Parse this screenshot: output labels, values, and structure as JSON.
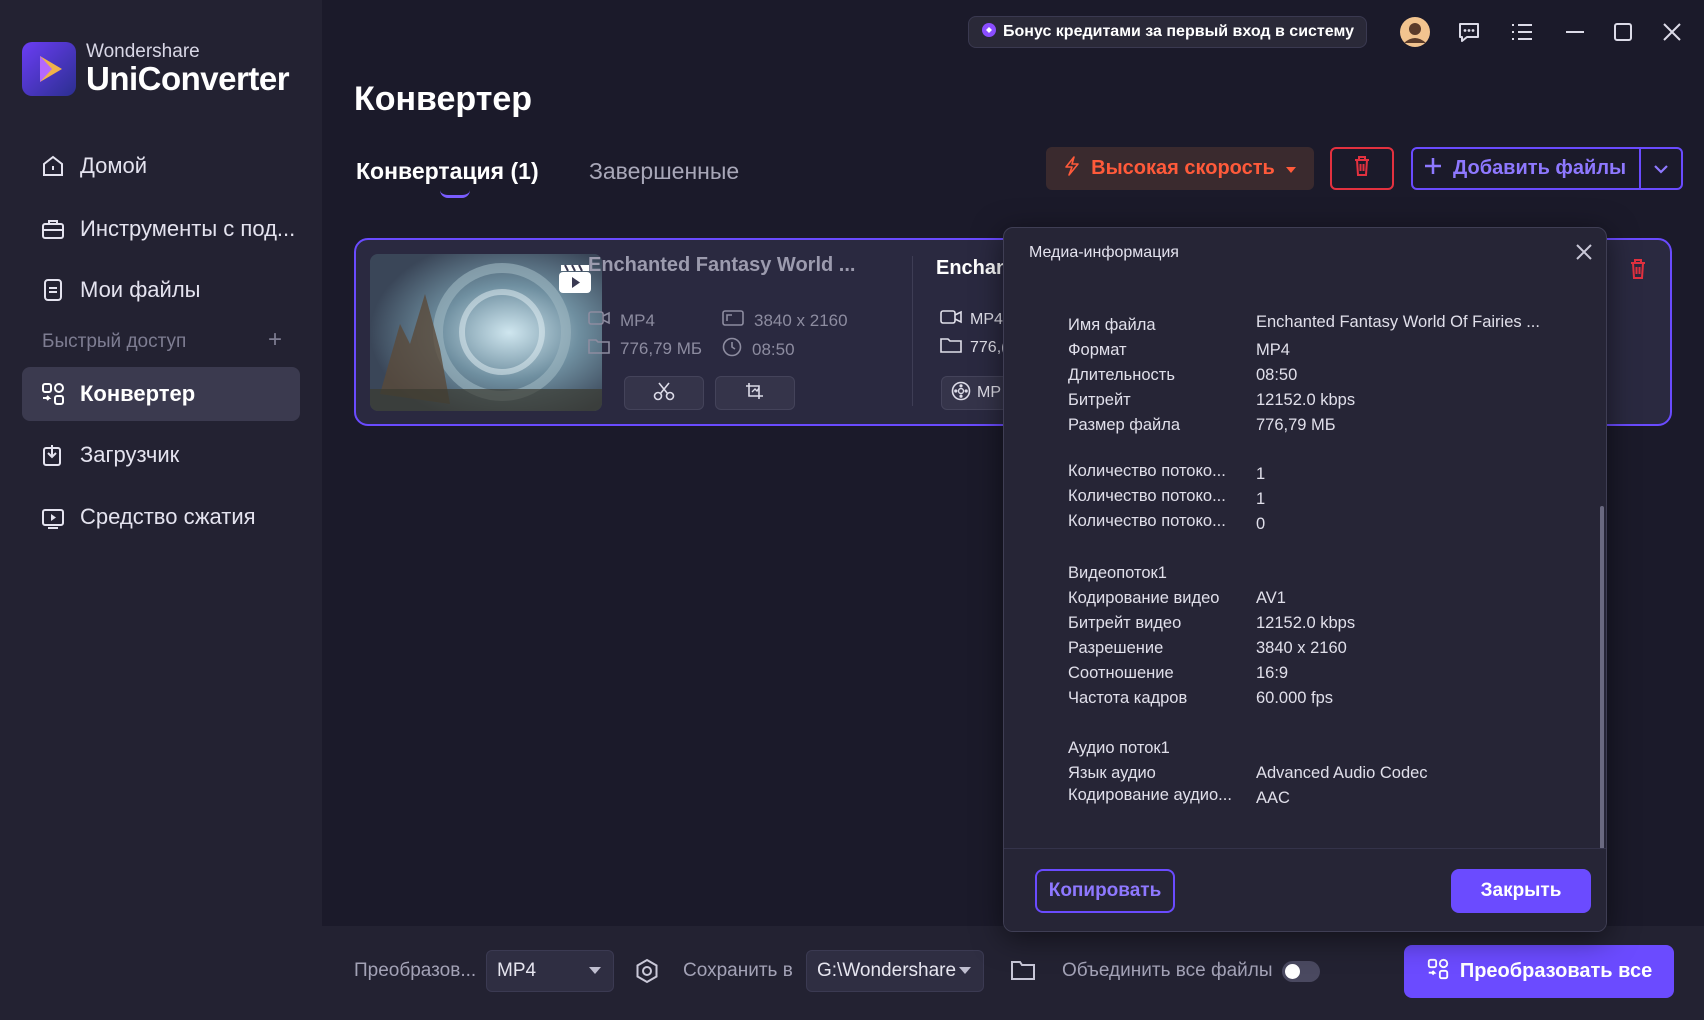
{
  "app": {
    "brand_small": "Wondershare",
    "brand_big": "UniConverter"
  },
  "sidebar": {
    "items": [
      {
        "label": "Домой",
        "icon": "home-icon"
      },
      {
        "label": "Инструменты с под...",
        "icon": "toolbox-icon"
      },
      {
        "label": "Мои файлы",
        "icon": "files-icon"
      },
      {
        "label": "Конвертер",
        "icon": "converter-icon"
      },
      {
        "label": "Загрузчик",
        "icon": "download-icon"
      },
      {
        "label": "Средство сжатия",
        "icon": "compress-icon"
      }
    ],
    "quick_access": "Быстрый доступ",
    "quick_add": "+"
  },
  "topbar": {
    "bonus": "Бонус кредитами за первый вход в систему"
  },
  "main": {
    "title": "Конвертер",
    "tabs": [
      "Конвертация (1)",
      "Завершенные"
    ],
    "speed_button": "Высокая скорость",
    "add_files": "Добавить файлы"
  },
  "file": {
    "title": "Enchanted Fantasy World ...",
    "format": "MP4",
    "resolution": "3840 x 2160",
    "size": "776,79 МБ",
    "duration": "08:50",
    "output_title": "Enchan",
    "output_format": "MP4",
    "output_size": "776,(",
    "output_target": "MP"
  },
  "panel": {
    "title": "Медиа-информация",
    "rows": [
      {
        "label": "Имя файла",
        "value": "Enchanted Fantasy World Of Fairies   ..."
      },
      {
        "label": "Формат",
        "value": "MP4"
      },
      {
        "label": "Длительность",
        "value": "08:50"
      },
      {
        "label": "Битрейт",
        "value": "12152.0 kbps"
      },
      {
        "label": "Размер файла",
        "value": "776,79 МБ"
      },
      {
        "label": "Количество потоко...",
        "value": "1"
      },
      {
        "label": "Количество потоко...",
        "value": "1"
      },
      {
        "label": "Количество потоко...",
        "value": "0"
      },
      {
        "label": "Видеопоток1",
        "value": ""
      },
      {
        "label": "Кодирование видео",
        "value": "AV1"
      },
      {
        "label": "Битрейт видео",
        "value": "12152.0 kbps"
      },
      {
        "label": "Разрешение",
        "value": "3840 x 2160"
      },
      {
        "label": "Соотношение",
        "value": "16:9"
      },
      {
        "label": "Частота кадров",
        "value": "60.000 fps"
      },
      {
        "label": "Аудио поток1",
        "value": ""
      },
      {
        "label": "Язык аудио",
        "value": "Advanced Audio Codec"
      },
      {
        "label": "Кодирование аудио...",
        "value": "AAC"
      }
    ],
    "copy": "Копировать",
    "close": "Закрыть"
  },
  "bottom": {
    "convert_label": "Преобразов...",
    "format": "MP4",
    "save_label": "Сохранить в",
    "save_path": "G:\\Wondershare U",
    "merge_label": "Объединить все файлы",
    "convert_all": "Преобразовать все"
  },
  "colors": {
    "accent": "#6b4bff",
    "danger": "#e3313f",
    "speed": "#ff5a3a"
  }
}
